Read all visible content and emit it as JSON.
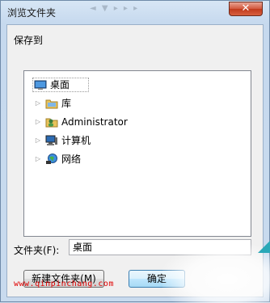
{
  "window": {
    "title": "浏览文件夹"
  },
  "title_bar": {
    "close_glyph": "✕",
    "ghost_toolbar": "◄ ▼ ▸ ▸ ▸"
  },
  "dialog": {
    "save_to_label": "保存到"
  },
  "tree": {
    "items": [
      {
        "label": "桌面",
        "icon": "desktop-icon",
        "expandable": false,
        "selected": true
      },
      {
        "label": "库",
        "icon": "library-icon",
        "expandable": true
      },
      {
        "label": "Administrator",
        "icon": "user-folder-icon",
        "expandable": true
      },
      {
        "label": "计算机",
        "icon": "computer-icon",
        "expandable": true
      },
      {
        "label": "网络",
        "icon": "network-icon",
        "expandable": true
      }
    ],
    "expander_glyph": "▷"
  },
  "folder": {
    "label": "文件夹(F):",
    "value": "桌面"
  },
  "buttons": {
    "new_folder": "新建文件夹(M)",
    "ok": "确定"
  },
  "watermark": {
    "text": "www.qinpinchang.com"
  }
}
